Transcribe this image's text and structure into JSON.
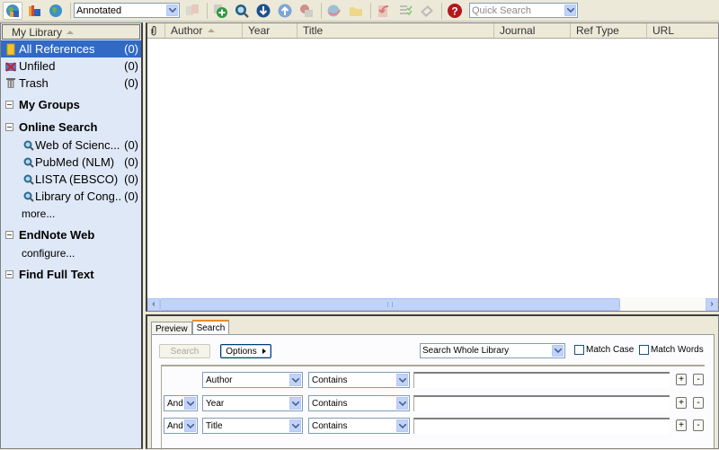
{
  "toolbar": {
    "style_select": "Annotated",
    "quick_search_placeholder": "Quick Search",
    "buttons": [
      {
        "name": "local-library-mode-icon",
        "active": true
      },
      {
        "name": "integrated-library-mode-icon"
      },
      {
        "name": "online-search-mode-icon"
      },
      {
        "name": "insert-citation-icon"
      },
      {
        "name": "new-reference-icon"
      },
      {
        "name": "online-search-icon"
      },
      {
        "name": "import-icon"
      },
      {
        "name": "export-icon"
      },
      {
        "name": "find-full-text-icon"
      },
      {
        "name": "open-link-icon"
      },
      {
        "name": "open-file-icon"
      },
      {
        "name": "insert-in-word-icon"
      },
      {
        "name": "format-bibliography-icon"
      },
      {
        "name": "sync-icon"
      },
      {
        "name": "help-icon"
      }
    ]
  },
  "sidebar": {
    "header": "My Library",
    "library_items": [
      {
        "label": "All References",
        "count": "(0)",
        "selected": true
      },
      {
        "label": "Unfiled",
        "count": "(0)"
      },
      {
        "label": "Trash",
        "count": "(0)"
      }
    ],
    "groups": {
      "my_groups": "My Groups",
      "online_search": "Online Search",
      "endnote_web": "EndNote Web",
      "find_full_text": "Find Full Text"
    },
    "online_items": [
      {
        "label": "Web of Scienc...",
        "count": "(0)"
      },
      {
        "label": "PubMed (NLM)",
        "count": "(0)"
      },
      {
        "label": "LISTA (EBSCO)",
        "count": "(0)"
      },
      {
        "label": "Library of Cong...",
        "count": "(0)"
      }
    ],
    "online_more": "more...",
    "endnote_configure": "configure..."
  },
  "reference_list": {
    "columns": [
      "Author",
      "Year",
      "Title",
      "Journal",
      "Ref Type",
      "URL"
    ],
    "sorted_column": "Author",
    "rows": []
  },
  "bottom_panel": {
    "tabs": [
      {
        "label": "Preview",
        "active": false
      },
      {
        "label": "Search",
        "active": true
      }
    ],
    "search_button": "Search",
    "options_button": "Options",
    "scope_select": "Search Whole Library",
    "match_case": "Match Case",
    "match_words": "Match Words",
    "criteria": [
      {
        "bool": "",
        "field": "Author",
        "operator": "Contains",
        "value": ""
      },
      {
        "bool": "And",
        "field": "Year",
        "operator": "Contains",
        "value": ""
      },
      {
        "bool": "And",
        "field": "Title",
        "operator": "Contains",
        "value": ""
      }
    ],
    "add_label": "+",
    "remove_label": "-"
  }
}
